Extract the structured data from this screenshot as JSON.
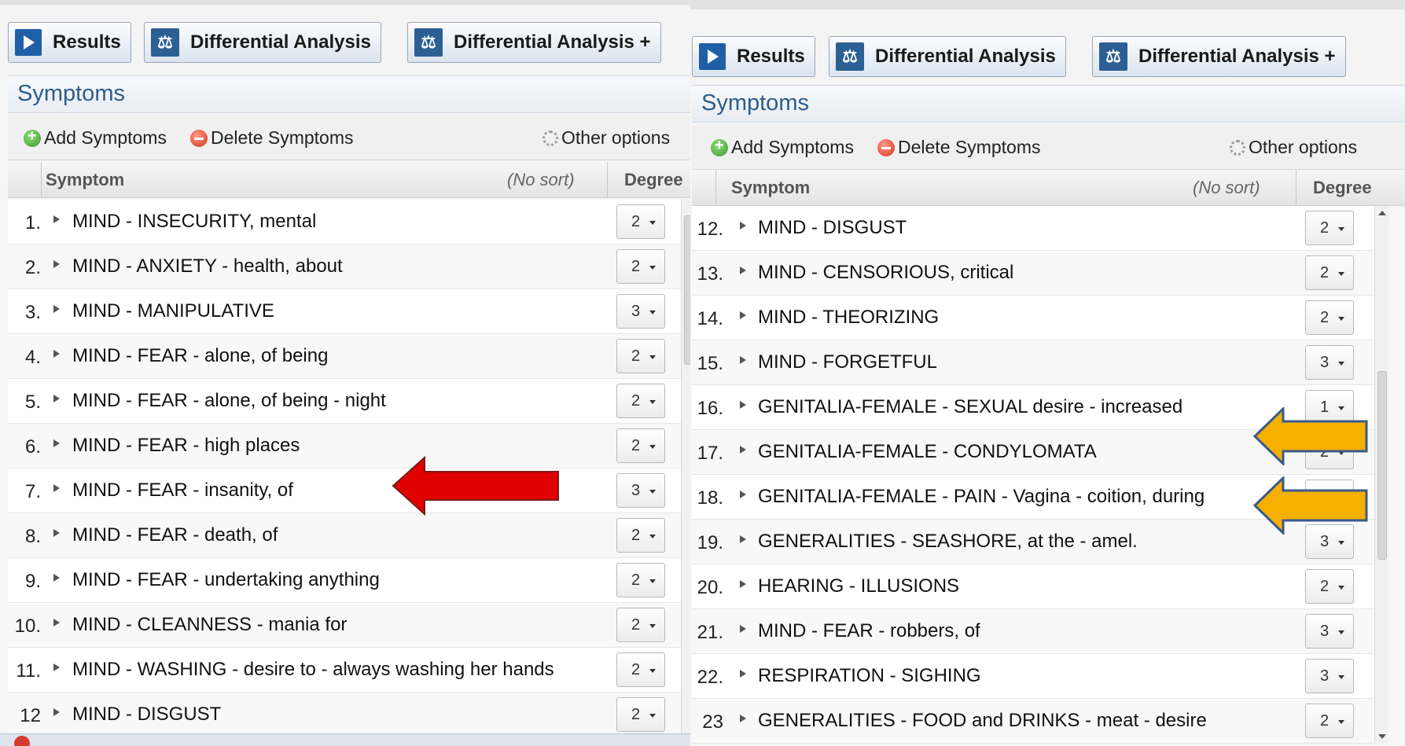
{
  "left_panel": {
    "buttons": {
      "results": "Results",
      "differential": "Differential Analysis",
      "differential_plus": "Differential Analysis +"
    },
    "section_title": "Symptoms",
    "options": {
      "add": "Add Symptoms",
      "delete": "Delete Symptoms",
      "other": "Other options"
    },
    "columns": {
      "symptom": "Symptom",
      "sort": "(No sort)",
      "degree": "Degree"
    },
    "rows": [
      {
        "num": "1.",
        "text": "MIND - INSECURITY, mental",
        "degree": "2"
      },
      {
        "num": "2.",
        "text": "MIND - ANXIETY - health, about",
        "degree": "2"
      },
      {
        "num": "3.",
        "text": "MIND - MANIPULATIVE",
        "degree": "3"
      },
      {
        "num": "4.",
        "text": "MIND - FEAR - alone, of being",
        "degree": "2"
      },
      {
        "num": "5.",
        "text": "MIND - FEAR - alone, of being - night",
        "degree": "2"
      },
      {
        "num": "6.",
        "text": "MIND - FEAR - high places",
        "degree": "2"
      },
      {
        "num": "7.",
        "text": "MIND - FEAR - insanity, of",
        "degree": "3"
      },
      {
        "num": "8.",
        "text": "MIND - FEAR - death, of",
        "degree": "2"
      },
      {
        "num": "9.",
        "text": "MIND - FEAR - undertaking anything",
        "degree": "2"
      },
      {
        "num": "10.",
        "text": "MIND - CLEANNESS - mania for",
        "degree": "2"
      },
      {
        "num": "11.",
        "text": "MIND - WASHING - desire to - always washing her hands",
        "degree": "2"
      },
      {
        "num": "12",
        "text": "MIND - DISGUST",
        "degree": "2"
      }
    ]
  },
  "right_panel": {
    "buttons": {
      "results": "Results",
      "differential": "Differential Analysis",
      "differential_plus": "Differential Analysis +"
    },
    "section_title": "Symptoms",
    "options": {
      "add": "Add Symptoms",
      "delete": "Delete Symptoms",
      "other": "Other options"
    },
    "columns": {
      "symptom": "Symptom",
      "sort": "(No sort)",
      "degree": "Degree"
    },
    "rows": [
      {
        "num": "12.",
        "text": "MIND - DISGUST",
        "degree": "2"
      },
      {
        "num": "13.",
        "text": "MIND - CENSORIOUS, critical",
        "degree": "2"
      },
      {
        "num": "14.",
        "text": "MIND - THEORIZING",
        "degree": "2"
      },
      {
        "num": "15.",
        "text": "MIND - FORGETFUL",
        "degree": "3"
      },
      {
        "num": "16.",
        "text": "GENITALIA-FEMALE - SEXUAL desire - increased",
        "degree": "1"
      },
      {
        "num": "17.",
        "text": "GENITALIA-FEMALE - CONDYLOMATA",
        "degree": "2"
      },
      {
        "num": "18.",
        "text": "GENITALIA-FEMALE - PAIN - Vagina - coition, during",
        "degree": ""
      },
      {
        "num": "19.",
        "text": "GENERALITIES - SEASHORE, at the - amel.",
        "degree": "3"
      },
      {
        "num": "20.",
        "text": "HEARING - ILLUSIONS",
        "degree": "2"
      },
      {
        "num": "21.",
        "text": "MIND - FEAR - robbers, of",
        "degree": "3"
      },
      {
        "num": "22.",
        "text": "RESPIRATION - SIGHING",
        "degree": "3"
      },
      {
        "num": "23",
        "text": "GENERALITIES - FOOD and DRINKS - meat - desire",
        "degree": "2"
      }
    ]
  },
  "annotations": {
    "red_arrow_color": "#e00000",
    "orange_arrow_color": "#f5b000"
  }
}
